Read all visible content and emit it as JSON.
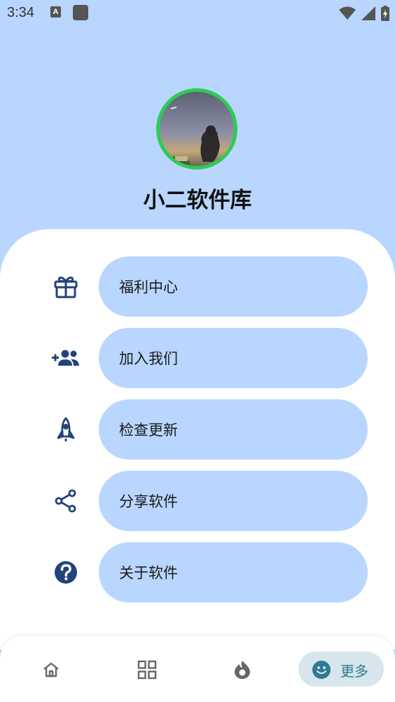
{
  "status_bar": {
    "time": "3:34",
    "notification_letter": "A"
  },
  "profile": {
    "app_name": "小二软件库"
  },
  "menu": {
    "items": [
      {
        "label": "福利中心",
        "icon": "gift-icon"
      },
      {
        "label": "加入我们",
        "icon": "add-group-icon"
      },
      {
        "label": "检查更新",
        "icon": "rocket-icon"
      },
      {
        "label": "分享软件",
        "icon": "share-icon"
      },
      {
        "label": "关于软件",
        "icon": "help-icon"
      }
    ]
  },
  "bottom_nav": {
    "items": [
      {
        "icon": "home-icon"
      },
      {
        "icon": "grid-icon"
      },
      {
        "icon": "compass-icon"
      }
    ],
    "active": {
      "label": "更多",
      "icon": "smiley-icon"
    }
  },
  "colors": {
    "header_bg": "#b9d6ff",
    "pill_bg": "#b9d6ff",
    "icon_color": "#22447a",
    "avatar_ring": "#2ecc55",
    "active_nav_bg": "#d6e6ec",
    "active_nav_text": "#2e7a93"
  }
}
